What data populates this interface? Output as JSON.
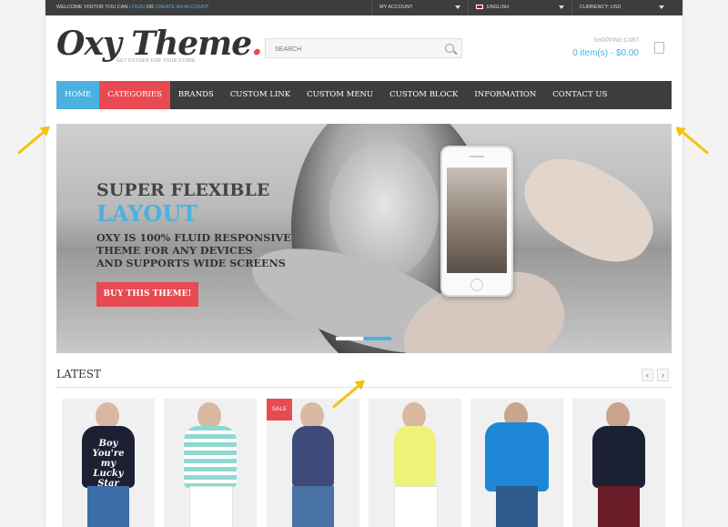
{
  "topbar": {
    "welcome_prefix": "WELCOME VISITOR YOU CAN",
    "login": "LOGIN",
    "or": "OR",
    "create_account": "CREATE AN ACCOUNT.",
    "my_account": "MY ACCOUNT",
    "language": "ENGLISH",
    "currency": "CURRENCY: USD"
  },
  "header": {
    "logo_text": "Oxy Theme",
    "logo_dot": ".",
    "tagline": "GET OXYGEN FOR YOUR STORE",
    "search_placeholder": "SEARCH",
    "cart_label": "SHOPPING CART",
    "cart_total": "0 item(s) - $0.00"
  },
  "nav": {
    "items": [
      "HOME",
      "CATEGORIES",
      "BRANDS",
      "CUSTOM LINK",
      "CUSTOM MENU",
      "CUSTOM BLOCK",
      "INFORMATION",
      "CONTACT US"
    ]
  },
  "banner": {
    "title_line1": "SUPER FLEXIBLE",
    "title_line2": "LAYOUT",
    "body_line1": "OXY IS 100% FLUID RESPONSIVE",
    "body_line2": "THEME FOR ANY DEVICES",
    "body_line3": "AND SUPPORTS WIDE SCREENS",
    "button": "BUY THIS THEME!",
    "slides_total": 2,
    "active_slide": 2
  },
  "latest": {
    "heading": "LATEST",
    "prev": "‹",
    "next": "›",
    "sale_badge": "SALE",
    "shirt_print": "Boy You're my Lucky Star"
  },
  "colors": {
    "accent_blue": "#4ab1e0",
    "accent_red": "#e84a52",
    "dark_bar": "#3d3d3d",
    "arrow_yellow": "#f4c20d"
  }
}
